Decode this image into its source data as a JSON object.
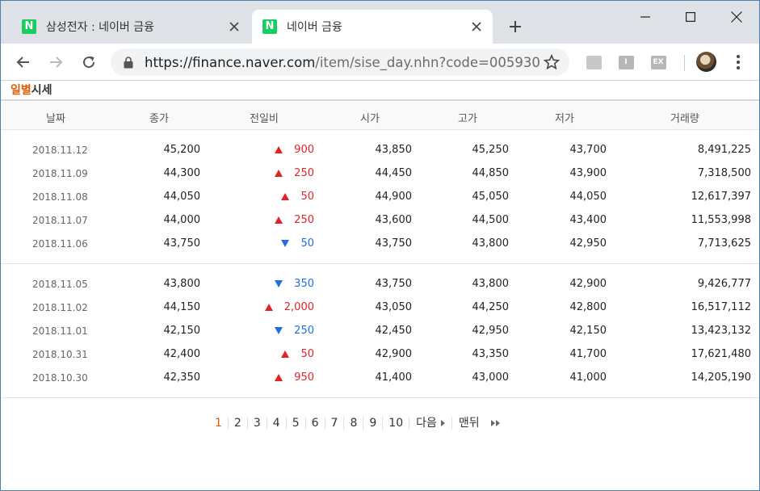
{
  "browser": {
    "tabs": [
      {
        "favicon": "N",
        "title": "삼성전자 : 네이버 금융",
        "active": false
      },
      {
        "favicon": "N",
        "title": "네이버 금융",
        "active": true
      }
    ],
    "url_host": "https://finance.naver.com",
    "url_path": "/item/sise_day.nhn?code=005930",
    "extensions": [
      "",
      "I",
      "EX"
    ]
  },
  "section": {
    "title_accent": "일별",
    "title_rest": "시세"
  },
  "table": {
    "headers": [
      "날짜",
      "종가",
      "전일비",
      "시가",
      "고가",
      "저가",
      "거래량"
    ],
    "group1": [
      {
        "date": "2018.11.12",
        "close": "45,200",
        "dir": "up",
        "change": "900",
        "open": "43,850",
        "high": "45,250",
        "low": "43,700",
        "volume": "8,491,225"
      },
      {
        "date": "2018.11.09",
        "close": "44,300",
        "dir": "up",
        "change": "250",
        "open": "44,450",
        "high": "44,850",
        "low": "43,900",
        "volume": "7,318,500"
      },
      {
        "date": "2018.11.08",
        "close": "44,050",
        "dir": "up",
        "change": "50",
        "open": "44,900",
        "high": "45,050",
        "low": "44,050",
        "volume": "12,617,397"
      },
      {
        "date": "2018.11.07",
        "close": "44,000",
        "dir": "up",
        "change": "250",
        "open": "43,600",
        "high": "44,500",
        "low": "43,400",
        "volume": "11,553,998"
      },
      {
        "date": "2018.11.06",
        "close": "43,750",
        "dir": "down",
        "change": "50",
        "open": "43,750",
        "high": "43,800",
        "low": "42,950",
        "volume": "7,713,625"
      }
    ],
    "group2": [
      {
        "date": "2018.11.05",
        "close": "43,800",
        "dir": "down",
        "change": "350",
        "open": "43,750",
        "high": "43,800",
        "low": "42,900",
        "volume": "9,426,777"
      },
      {
        "date": "2018.11.02",
        "close": "44,150",
        "dir": "up",
        "change": "2,000",
        "open": "43,050",
        "high": "44,250",
        "low": "42,800",
        "volume": "16,517,112"
      },
      {
        "date": "2018.11.01",
        "close": "42,150",
        "dir": "down",
        "change": "250",
        "open": "42,450",
        "high": "42,950",
        "low": "42,150",
        "volume": "13,423,132"
      },
      {
        "date": "2018.10.31",
        "close": "42,400",
        "dir": "up",
        "change": "50",
        "open": "42,900",
        "high": "43,350",
        "low": "41,700",
        "volume": "17,621,480"
      },
      {
        "date": "2018.10.30",
        "close": "42,350",
        "dir": "up",
        "change": "950",
        "open": "41,400",
        "high": "43,000",
        "low": "41,000",
        "volume": "14,205,190"
      }
    ]
  },
  "pagination": {
    "pages": [
      "1",
      "2",
      "3",
      "4",
      "5",
      "6",
      "7",
      "8",
      "9",
      "10"
    ],
    "current": "1",
    "next_label": "다음",
    "last_label": "맨뒤"
  },
  "colors": {
    "up": "#e12228",
    "down": "#1e6ee0",
    "accent": "#e05a00",
    "naver_green": "#19ce60"
  }
}
